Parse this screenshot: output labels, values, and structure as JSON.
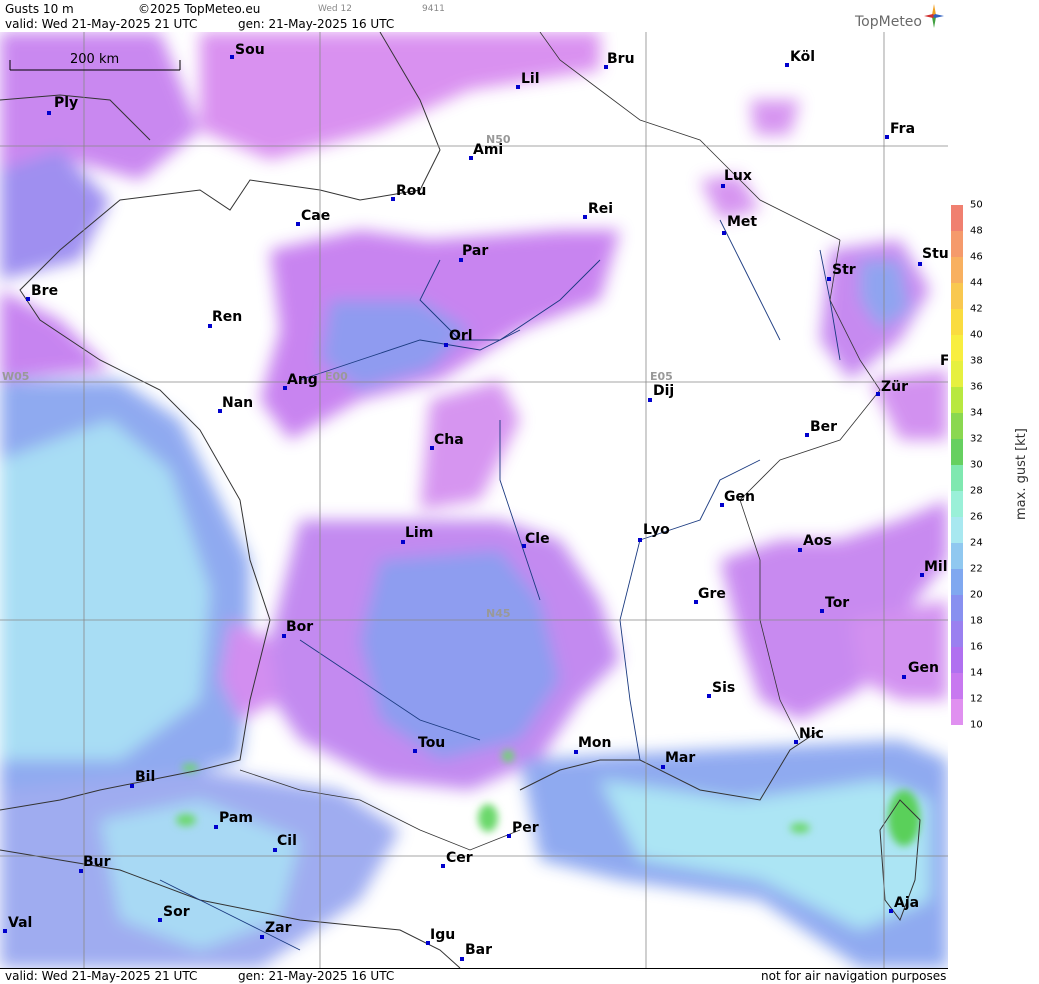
{
  "header": {
    "product": "Gusts 10 m",
    "copyright": "©2025 TopMeteo.eu",
    "valid": "valid:  Wed  21-May-2025  21 UTC",
    "gen": "gen: 21-May-2025 16 UTC",
    "day": "Wed 12",
    "code": "9411",
    "brand": "TopMeteo"
  },
  "scale": {
    "label": "200 km"
  },
  "grid_labels": [
    "N50",
    "N45",
    "W05",
    "E00",
    "E05"
  ],
  "cities": [
    {
      "name": "Sou"
    },
    {
      "name": "Bru"
    },
    {
      "name": "Köl"
    },
    {
      "name": "Lil"
    },
    {
      "name": "Ply"
    },
    {
      "name": "Ami"
    },
    {
      "name": "Fra"
    },
    {
      "name": "Lux"
    },
    {
      "name": "Rou"
    },
    {
      "name": "Cae"
    },
    {
      "name": "Rei"
    },
    {
      "name": "Met"
    },
    {
      "name": "Par"
    },
    {
      "name": "Str"
    },
    {
      "name": "Stu"
    },
    {
      "name": "Bre"
    },
    {
      "name": "Ren"
    },
    {
      "name": "Orl"
    },
    {
      "name": "Ang"
    },
    {
      "name": "Nan"
    },
    {
      "name": "Dij"
    },
    {
      "name": "Zür"
    },
    {
      "name": "Ber"
    },
    {
      "name": "Cha"
    },
    {
      "name": "Gen"
    },
    {
      "name": "Lim"
    },
    {
      "name": "Cle"
    },
    {
      "name": "Lyo"
    },
    {
      "name": "Aos"
    },
    {
      "name": "Mil"
    },
    {
      "name": "Gre"
    },
    {
      "name": "Tor"
    },
    {
      "name": "Bor"
    },
    {
      "name": "Sis"
    },
    {
      "name": "Gen"
    },
    {
      "name": "Nic"
    },
    {
      "name": "Tou"
    },
    {
      "name": "Mon"
    },
    {
      "name": "Mar"
    },
    {
      "name": "Bil"
    },
    {
      "name": "Pam"
    },
    {
      "name": "Cil"
    },
    {
      "name": "Per"
    },
    {
      "name": "Bur"
    },
    {
      "name": "Cer"
    },
    {
      "name": "Aja"
    },
    {
      "name": "Val"
    },
    {
      "name": "Sor"
    },
    {
      "name": "Zar"
    },
    {
      "name": "Igu"
    },
    {
      "name": "Bar"
    },
    {
      "name": "F"
    }
  ],
  "legend": {
    "title": "max. gust [kt]",
    "ticks": [
      "50",
      "48",
      "46",
      "44",
      "42",
      "40",
      "38",
      "36",
      "34",
      "32",
      "30",
      "28",
      "26",
      "24",
      "22",
      "20",
      "18",
      "16",
      "14",
      "12",
      "10"
    ],
    "colors": [
      "#f08070",
      "#f59a6c",
      "#f8b060",
      "#f9c850",
      "#fadc40",
      "#f8ee40",
      "#e6f040",
      "#b8e840",
      "#8ad850",
      "#66d060",
      "#7fe8b0",
      "#9af0d8",
      "#a8e8f0",
      "#90c8f0",
      "#80a8f0",
      "#8890f0",
      "#9a80f0",
      "#b070f0",
      "#c878f0",
      "#e090f0"
    ]
  },
  "footer": {
    "valid": "valid:  Wed  21-May-2025  21 UTC",
    "gen": "gen: 21-May-2025 16 UTC",
    "disclaimer": "not for air navigation purposes"
  }
}
